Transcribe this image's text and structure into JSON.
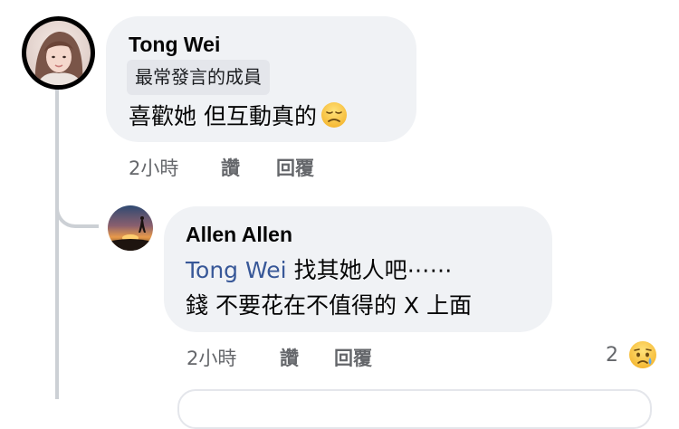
{
  "comments": [
    {
      "author": "Tong Wei",
      "badge": "最常發言的成員",
      "text": "喜歡她 但互動真的",
      "emoji": "disappointed-face-icon",
      "time": "2小時",
      "read_label": "讚",
      "reply_label": "回覆"
    },
    {
      "author": "Allen Allen",
      "mention": "Tong Wei",
      "text_line1": "找其她人吧⋯⋯",
      "text_line2": "錢 不要花在不值得的 X 上面",
      "time": "2小時",
      "read_label": "讚",
      "reply_label": "回覆",
      "reaction_count": "2",
      "reaction_icon": "crying-face-icon"
    }
  ],
  "colors": {
    "bubble": "#f0f2f5",
    "badge": "#e4e6eb",
    "mention": "#385898",
    "meta": "#65676b",
    "thread_line": "#ccd0d5"
  }
}
